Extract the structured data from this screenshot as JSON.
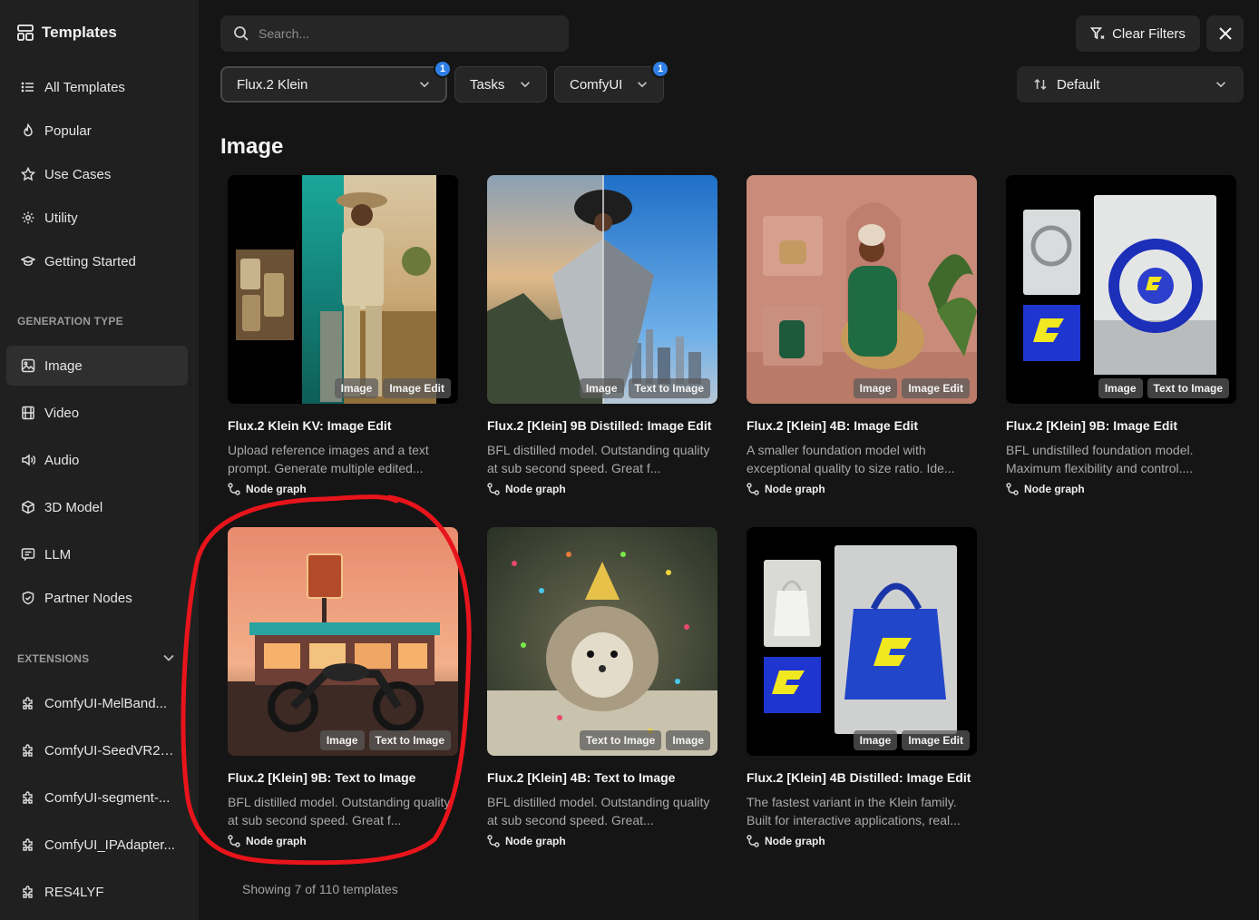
{
  "sidebar": {
    "brand": "Templates",
    "nav": [
      {
        "label": "All Templates",
        "icon": "list-icon"
      },
      {
        "label": "Popular",
        "icon": "flame-icon"
      },
      {
        "label": "Use Cases",
        "icon": "star-icon"
      },
      {
        "label": "Utility",
        "icon": "gear-icon"
      },
      {
        "label": "Getting Started",
        "icon": "graduation-cap-icon"
      }
    ],
    "generation_title": "GENERATION TYPE",
    "generation": [
      {
        "label": "Image",
        "icon": "image-icon",
        "active": true
      },
      {
        "label": "Video",
        "icon": "film-icon"
      },
      {
        "label": "Audio",
        "icon": "speaker-icon"
      },
      {
        "label": "3D Model",
        "icon": "cube-icon"
      },
      {
        "label": "LLM",
        "icon": "chat-icon"
      },
      {
        "label": "Partner Nodes",
        "icon": "badge-icon"
      }
    ],
    "extensions_title": "EXTENSIONS",
    "extensions": [
      {
        "label": "ComfyUI-MelBand...",
        "icon": "puzzle-icon"
      },
      {
        "label": "ComfyUI-SeedVR2_...",
        "icon": "puzzle-icon"
      },
      {
        "label": "ComfyUI-segment-...",
        "icon": "puzzle-icon"
      },
      {
        "label": "ComfyUI_IPAdapter...",
        "icon": "puzzle-icon"
      },
      {
        "label": "RES4LYF",
        "icon": "puzzle-icon"
      }
    ]
  },
  "topbar": {
    "search_placeholder": "Search...",
    "clear_filters": "Clear Filters"
  },
  "filters": [
    {
      "label": "Flux.2 Klein",
      "badge": "1"
    },
    {
      "label": "Tasks",
      "badge": ""
    },
    {
      "label": "ComfyUI",
      "badge": "1"
    }
  ],
  "sort": {
    "label": "Default"
  },
  "section": {
    "heading": "Image"
  },
  "cards": [
    {
      "title": "Flux.2 Klein KV: Image Edit",
      "desc": "Upload reference images and a text prompt. Generate multiple edited...",
      "tags": [
        "Image",
        "Image Edit"
      ],
      "meta": "Node graph"
    },
    {
      "title": "Flux.2 [Klein] 9B Distilled: Image Edit",
      "desc": "BFL distilled model. Outstanding quality at sub second speed. Great f...",
      "tags": [
        "Image",
        "Text to Image"
      ],
      "meta": "Node graph"
    },
    {
      "title": "Flux.2 [Klein] 4B: Image Edit",
      "desc": "A smaller foundation model with exceptional quality to size ratio. Ide...",
      "tags": [
        "Image",
        "Image Edit"
      ],
      "meta": "Node graph"
    },
    {
      "title": "Flux.2 [Klein] 9B: Image Edit",
      "desc": "BFL undistilled foundation model. Maximum flexibility and control....",
      "tags": [
        "Image",
        "Text to Image"
      ],
      "meta": "Node graph"
    },
    {
      "title": "Flux.2 [Klein] 9B: Text to Image",
      "desc": "BFL distilled model. Outstanding quality at sub second speed. Great f...",
      "tags": [
        "Image",
        "Text to Image"
      ],
      "meta": "Node graph"
    },
    {
      "title": "Flux.2 [Klein] 4B: Text to Image",
      "desc": "BFL distilled model. Outstanding quality at sub second speed. Great...",
      "tags": [
        "Text to Image",
        "Image"
      ],
      "meta": "Node graph"
    },
    {
      "title": "Flux.2 [Klein] 4B Distilled: Image Edit",
      "desc": "The fastest variant in the Klein family. Built for interactive applications, real...",
      "tags": [
        "Image",
        "Image Edit"
      ],
      "meta": "Node graph"
    }
  ],
  "footer": {
    "count": "Showing 7 of 110 templates"
  },
  "colors": {
    "accent": "#2e7fe6",
    "annotation": "#e8141b"
  }
}
